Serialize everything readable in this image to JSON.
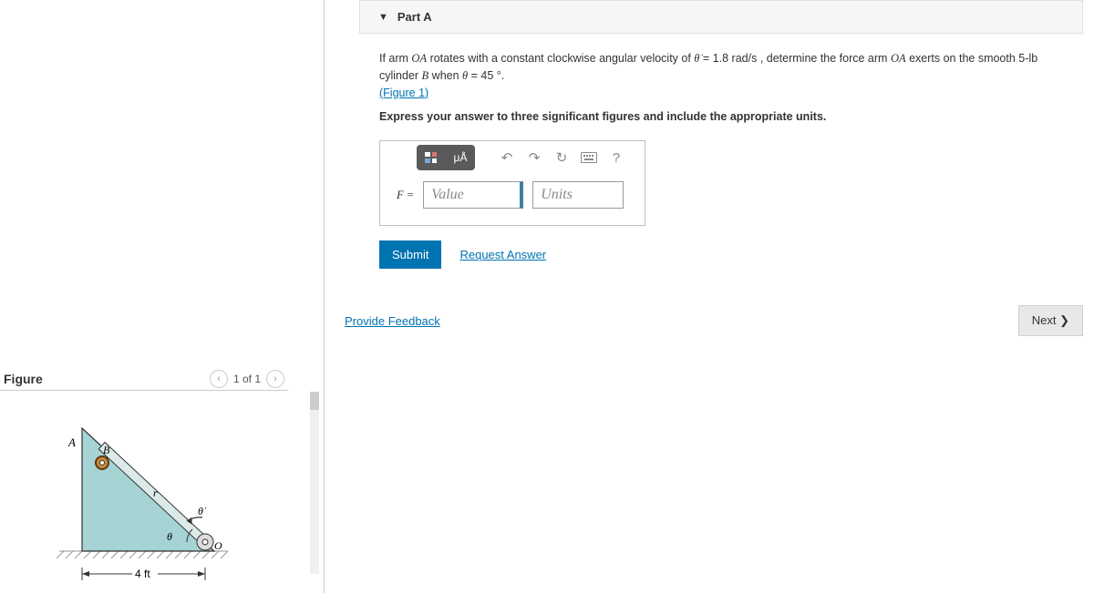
{
  "partA": {
    "title": "Part A",
    "problem_pre": "If arm ",
    "problem_oa1": "OA",
    "problem_mid1": " rotates with a constant clockwise angular velocity of ",
    "theta_dot": "θ̇",
    "problem_eq": " = 1.8 ",
    "units_rad": "rad/s",
    "problem_mid2": " , determine the force arm ",
    "problem_oa2": "OA",
    "problem_mid3": " exerts on the smooth ",
    "weight": "5-lb",
    "problem_mid4": " cylinder ",
    "cylB": "B",
    "problem_mid5": " when ",
    "theta": "θ",
    "problem_end": " = 45 °.",
    "figure_link": "(Figure 1)",
    "instruction": "Express your answer to three significant figures and include the appropriate units."
  },
  "toolbar": {
    "template": "template-icon",
    "special": "μÅ",
    "undo": "↶",
    "redo": "↷",
    "reset": "↻",
    "keyboard": "⌨",
    "help": "?"
  },
  "answer": {
    "var_label": "F =",
    "value_placeholder": "Value",
    "units_placeholder": "Units"
  },
  "actions": {
    "submit": "Submit",
    "request": "Request Answer",
    "feedback": "Provide Feedback",
    "next": "Next ❯"
  },
  "figure": {
    "title": "Figure",
    "pager": "1 of 1",
    "dim_label": "4 ft",
    "labels": {
      "A": "A",
      "B": "B",
      "O": "O",
      "r": "r",
      "theta": "θ",
      "thetadot": "θ̇"
    }
  }
}
